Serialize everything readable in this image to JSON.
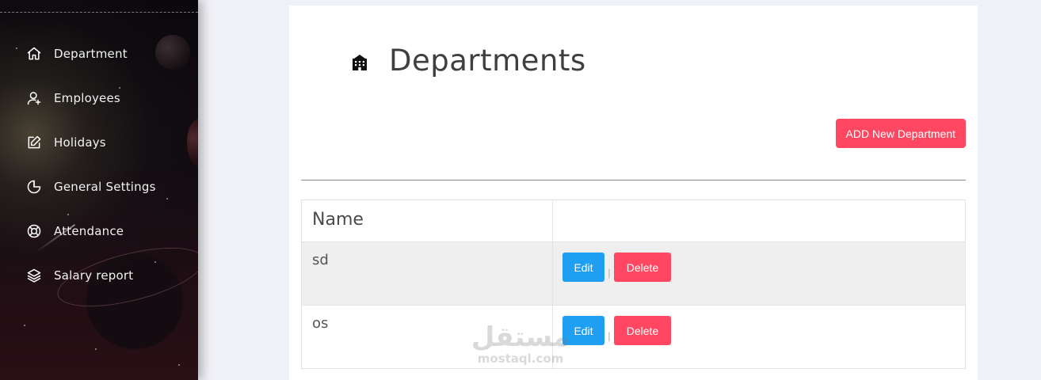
{
  "sidebar": {
    "items": [
      {
        "label": "Department",
        "icon": "home-icon"
      },
      {
        "label": "Employees",
        "icon": "users-icon"
      },
      {
        "label": "Holidays",
        "icon": "edit-icon"
      },
      {
        "label": "General Settings",
        "icon": "pie-chart-icon"
      },
      {
        "label": "Attendance",
        "icon": "life-buoy-icon"
      },
      {
        "label": "Salary report",
        "icon": "layers-icon"
      }
    ]
  },
  "main": {
    "title": "Departments",
    "title_icon": "building-icon",
    "add_button_label": "ADD New Department",
    "table": {
      "columns": [
        "Name",
        ""
      ],
      "rows": [
        {
          "name": "sd",
          "edit_label": "Edit",
          "separator": "|",
          "delete_label": "Delete"
        },
        {
          "name": "os",
          "edit_label": "Edit",
          "separator": "|",
          "delete_label": "Delete"
        }
      ]
    }
  },
  "watermark": {
    "arabic": "مستقل",
    "latin": "mostaql.com"
  },
  "colors": {
    "primary_red": "#ff4761",
    "edit_blue": "#1e9ff2",
    "panel_bg": "#ffffff",
    "page_bg": "#f0f1f6"
  }
}
